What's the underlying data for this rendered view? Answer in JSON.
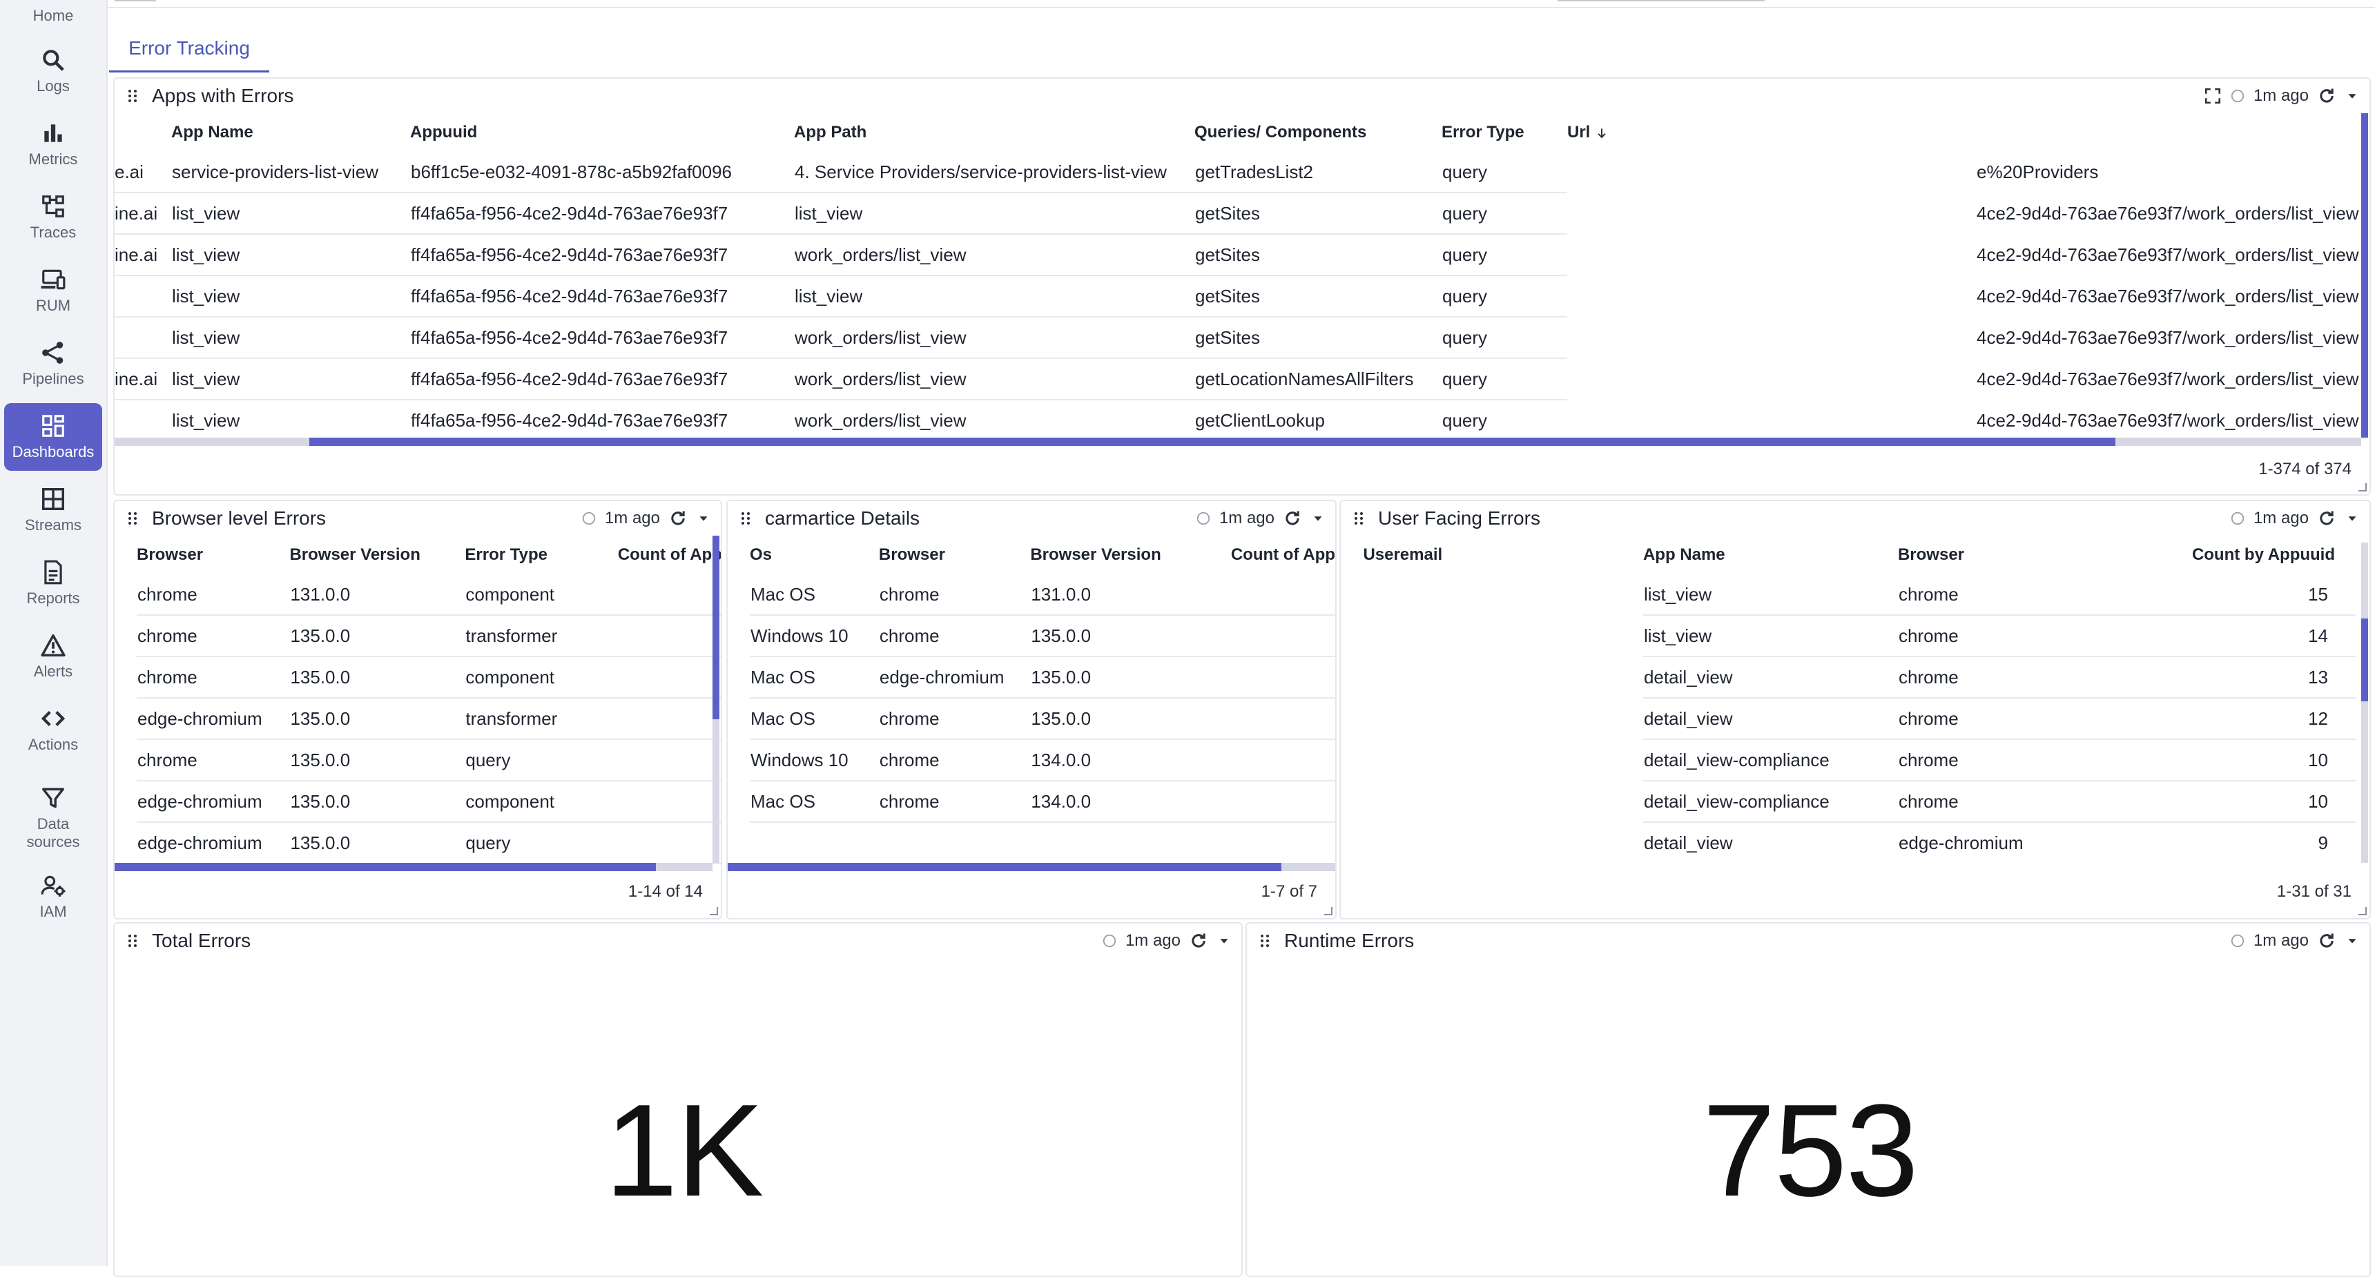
{
  "sidebar": {
    "items": [
      {
        "label": "Home",
        "icon": "home-icon"
      },
      {
        "label": "Logs",
        "icon": "search-icon"
      },
      {
        "label": "Metrics",
        "icon": "bar-chart-icon"
      },
      {
        "label": "Traces",
        "icon": "traces-icon"
      },
      {
        "label": "RUM",
        "icon": "devices-icon"
      },
      {
        "label": "Pipelines",
        "icon": "share-icon"
      },
      {
        "label": "Dashboards",
        "icon": "dashboard-icon",
        "active": true
      },
      {
        "label": "Streams",
        "icon": "grid-icon"
      },
      {
        "label": "Reports",
        "icon": "document-icon"
      },
      {
        "label": "Alerts",
        "icon": "warning-icon"
      },
      {
        "label": "Actions",
        "icon": "code-icon"
      },
      {
        "label": "Data sources",
        "icon": "filter-icon"
      },
      {
        "label": "IAM",
        "icon": "user-gear-icon"
      }
    ]
  },
  "tabs": [
    {
      "label": "Error Tracking",
      "active": true
    }
  ],
  "colors": {
    "accent": "#5b5fc7",
    "tab": "#4a58b5"
  },
  "panels": {
    "apps_with_errors": {
      "title": "Apps with Errors",
      "refreshed": "1m ago",
      "columns": [
        "App Name",
        "Appuuid",
        "App Path",
        "Queries/ Components",
        "Error Type",
        "Url"
      ],
      "rows": [
        {
          "prefix": "e.ai",
          "app": "service-providers-list-view",
          "uuid": "b6ff1c5e-e032-4091-878c-a5b92faf0096",
          "path": "4. Service Providers/service-providers-list-view",
          "query": "getTradesList2",
          "type": "query",
          "url": "e%20Providers"
        },
        {
          "prefix": "ine.ai",
          "app": "list_view",
          "uuid": "ff4fa65a-f956-4ce2-9d4d-763ae76e93f7",
          "path": "list_view",
          "query": "getSites",
          "type": "query",
          "url": "4ce2-9d4d-763ae76e93f7/work_orders/list_view"
        },
        {
          "prefix": "ine.ai",
          "app": "list_view",
          "uuid": "ff4fa65a-f956-4ce2-9d4d-763ae76e93f7",
          "path": "work_orders/list_view",
          "query": "getSites",
          "type": "query",
          "url": "4ce2-9d4d-763ae76e93f7/work_orders/list_view"
        },
        {
          "prefix": "",
          "app": "list_view",
          "uuid": "ff4fa65a-f956-4ce2-9d4d-763ae76e93f7",
          "path": "list_view",
          "query": "getSites",
          "type": "query",
          "url": "4ce2-9d4d-763ae76e93f7/work_orders/list_view"
        },
        {
          "prefix": "",
          "app": "list_view",
          "uuid": "ff4fa65a-f956-4ce2-9d4d-763ae76e93f7",
          "path": "work_orders/list_view",
          "query": "getSites",
          "type": "query",
          "url": "4ce2-9d4d-763ae76e93f7/work_orders/list_view"
        },
        {
          "prefix": "ine.ai",
          "app": "list_view",
          "uuid": "ff4fa65a-f956-4ce2-9d4d-763ae76e93f7",
          "path": "work_orders/list_view",
          "query": "getLocationNamesAllFilters",
          "type": "query",
          "url": "4ce2-9d4d-763ae76e93f7/work_orders/list_view"
        },
        {
          "prefix": "",
          "app": "list_view",
          "uuid": "ff4fa65a-f956-4ce2-9d4d-763ae76e93f7",
          "path": "work_orders/list_view",
          "query": "getClientLookup",
          "type": "query",
          "url": "4ce2-9d4d-763ae76e93f7/work_orders/list_view"
        }
      ],
      "pagination": "1-374 of 374"
    },
    "browser_level_errors": {
      "title": "Browser level Errors",
      "refreshed": "1m ago",
      "columns": [
        "Browser",
        "Browser Version",
        "Error Type",
        "Count of App"
      ],
      "rows": [
        [
          "chrome",
          "131.0.0",
          "component"
        ],
        [
          "chrome",
          "135.0.0",
          "transformer"
        ],
        [
          "chrome",
          "135.0.0",
          "component"
        ],
        [
          "edge-chromium",
          "135.0.0",
          "transformer"
        ],
        [
          "chrome",
          "135.0.0",
          "query"
        ],
        [
          "edge-chromium",
          "135.0.0",
          "component"
        ],
        [
          "edge-chromium",
          "135.0.0",
          "query"
        ]
      ],
      "pagination": "1-14 of 14"
    },
    "carmartice_details": {
      "title": "carmartice Details",
      "refreshed": "1m ago",
      "columns": [
        "Os",
        "Browser",
        "Browser Version",
        "Count of App U"
      ],
      "rows": [
        [
          "Mac OS",
          "chrome",
          "131.0.0"
        ],
        [
          "Windows 10",
          "chrome",
          "135.0.0"
        ],
        [
          "Mac OS",
          "edge-chromium",
          "135.0.0"
        ],
        [
          "Mac OS",
          "chrome",
          "135.0.0"
        ],
        [
          "Windows 10",
          "chrome",
          "134.0.0"
        ],
        [
          "Mac OS",
          "chrome",
          "134.0.0"
        ]
      ],
      "pagination": "1-7 of 7"
    },
    "user_facing_errors": {
      "title": "User Facing Errors",
      "refreshed": "1m ago",
      "columns": [
        "Useremail",
        "App Name",
        "Browser",
        "Count by Appuuid"
      ],
      "rows": [
        [
          "list_view",
          "chrome",
          "15"
        ],
        [
          "list_view",
          "chrome",
          "14"
        ],
        [
          "detail_view",
          "chrome",
          "13"
        ],
        [
          "detail_view",
          "chrome",
          "12"
        ],
        [
          "detail_view-compliance",
          "chrome",
          "10"
        ],
        [
          "detail_view-compliance",
          "chrome",
          "10"
        ],
        [
          "detail_view",
          "edge-chromium",
          "9"
        ]
      ],
      "pagination": "1-31 of 31"
    },
    "total_errors": {
      "title": "Total Errors",
      "refreshed": "1m ago",
      "value": "1K"
    },
    "runtime_errors": {
      "title": "Runtime Errors",
      "refreshed": "1m ago",
      "value": "753"
    }
  }
}
